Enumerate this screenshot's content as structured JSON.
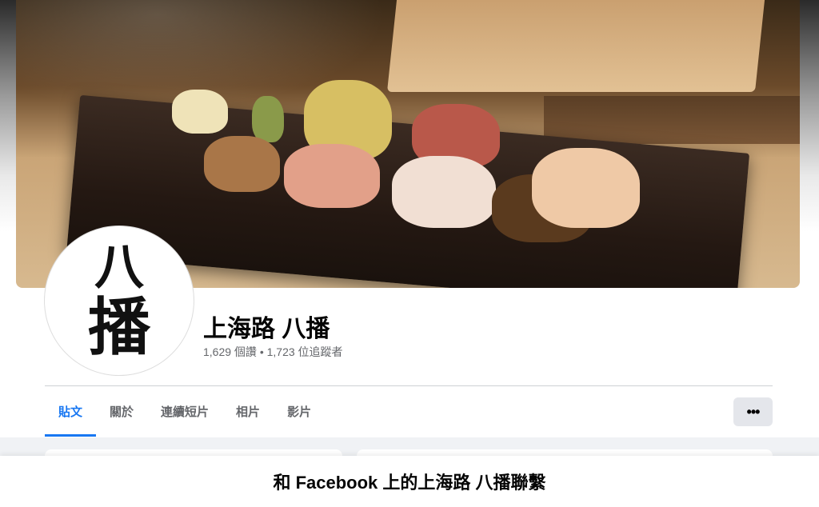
{
  "page": {
    "name": "上海路 八播",
    "stats": "1,629 個讚 • 1,723 位追蹤者",
    "avatar": {
      "char_top": "八",
      "char_bottom": "播"
    }
  },
  "tabs": [
    {
      "label": "貼文",
      "active": true
    },
    {
      "label": "關於",
      "active": false
    },
    {
      "label": "連續短片",
      "active": false
    },
    {
      "label": "相片",
      "active": false
    },
    {
      "label": "影片",
      "active": false
    }
  ],
  "more_button": {
    "icon": "more-horizontal-icon",
    "glyph": "•••"
  },
  "login_banner": {
    "text": "和 Facebook 上的上海路 八播聯繫"
  },
  "colors": {
    "accent": "#1877f2",
    "secondary_text": "#65676b",
    "button_bg": "#e4e6eb"
  }
}
